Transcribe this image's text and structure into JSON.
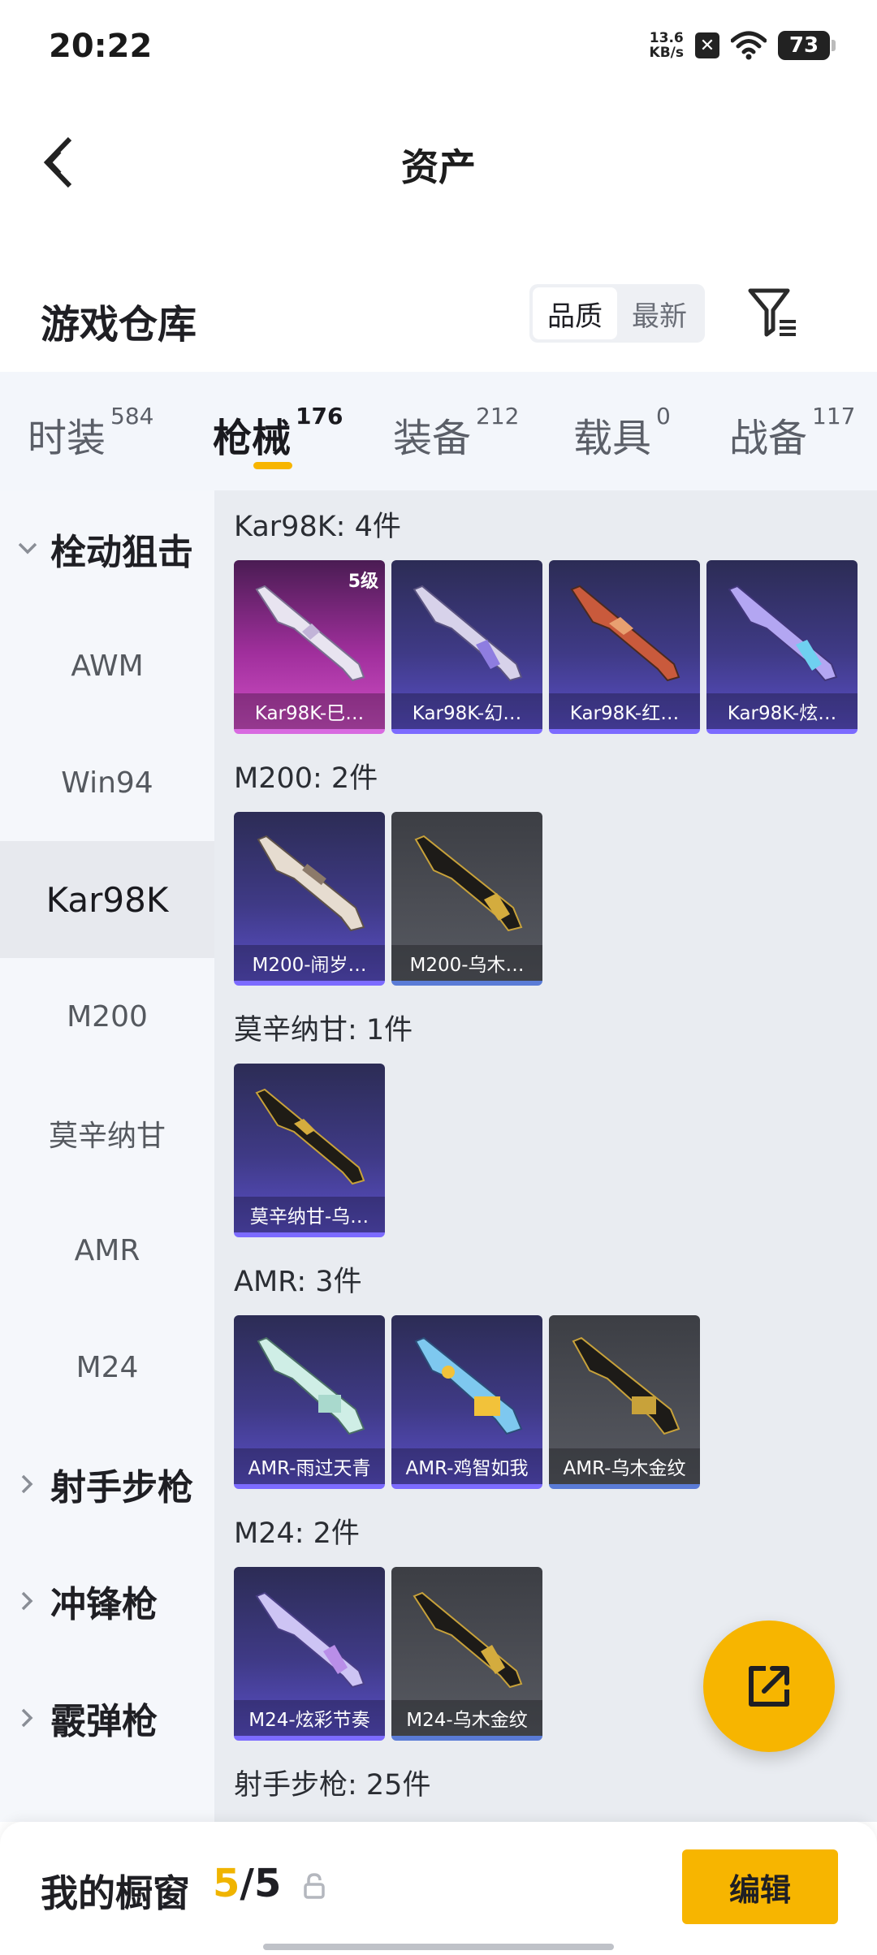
{
  "status_bar": {
    "time": "20:22",
    "net_speed_value": "13.6",
    "net_speed_unit": "KB/s",
    "battery": "73"
  },
  "header": {
    "title": "资产"
  },
  "section": {
    "title": "游戏仓库",
    "sort_options": [
      "品质",
      "最新"
    ],
    "active_sort": "品质"
  },
  "tabs": [
    {
      "label": "时装",
      "count": "584"
    },
    {
      "label": "枪械",
      "count": "176"
    },
    {
      "label": "装备",
      "count": "212"
    },
    {
      "label": "载具",
      "count": "0"
    },
    {
      "label": "战备",
      "count": "117"
    }
  ],
  "active_tab": "枪械",
  "sidebar": {
    "categories": [
      {
        "label": "栓动狙击",
        "expanded": true,
        "items": [
          "AWM",
          "Win94",
          "Kar98K",
          "M200",
          "莫辛纳甘",
          "AMR",
          "M24"
        ],
        "active_item": "Kar98K"
      },
      {
        "label": "射手步枪",
        "expanded": false
      },
      {
        "label": "冲锋枪",
        "expanded": false
      },
      {
        "label": "霰弹枪",
        "expanded": false
      }
    ]
  },
  "groups": [
    {
      "title": "Kar98K: 4件",
      "items": [
        {
          "name": "Kar98K-巳…",
          "rarity": "pink",
          "level": "5级"
        },
        {
          "name": "Kar98K-幻…",
          "rarity": "purple"
        },
        {
          "name": "Kar98K-红…",
          "rarity": "purple"
        },
        {
          "name": "Kar98K-炫…",
          "rarity": "purple"
        }
      ]
    },
    {
      "title": "M200: 2件",
      "items": [
        {
          "name": "M200-闹岁…",
          "rarity": "purple"
        },
        {
          "name": "M200-乌木…",
          "rarity": "gray"
        }
      ]
    },
    {
      "title": "莫辛纳甘: 1件",
      "items": [
        {
          "name": "莫辛纳甘-乌…",
          "rarity": "purple"
        }
      ]
    },
    {
      "title": "AMR: 3件",
      "items": [
        {
          "name": "AMR-雨过天青",
          "rarity": "purple"
        },
        {
          "name": "AMR-鸡智如我",
          "rarity": "purple"
        },
        {
          "name": "AMR-乌木金纹",
          "rarity": "gray"
        }
      ]
    },
    {
      "title": "M24: 2件",
      "items": [
        {
          "name": "M24-炫彩节奏",
          "rarity": "purple"
        },
        {
          "name": "M24-乌木金纹",
          "rarity": "gray"
        }
      ]
    },
    {
      "title": "射手步枪: 25件",
      "items": []
    }
  ],
  "showcase": {
    "label": "我的橱窗",
    "current": "5",
    "separator": "/",
    "total": "5",
    "edit_label": "编辑"
  },
  "colors": {
    "accent": "#f7b500",
    "purple_rarity": "#7c6bff",
    "pink_rarity": "#d86ae0",
    "gray_rarity": "#5a7bd6"
  }
}
